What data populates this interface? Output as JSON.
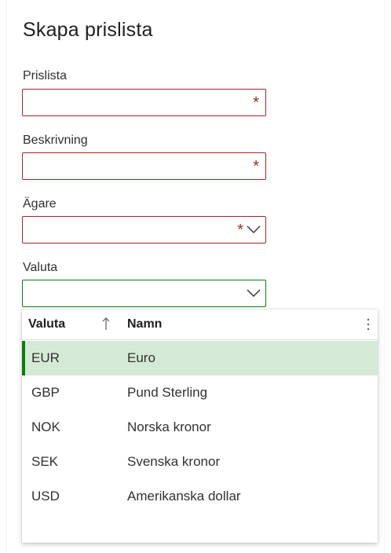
{
  "dialog": {
    "title": "Skapa prislista"
  },
  "fields": {
    "prislista": {
      "label": "Prislista",
      "value": "",
      "required": true
    },
    "beskrivning": {
      "label": "Beskrivning",
      "value": "",
      "required": true
    },
    "agare": {
      "label": "Ägare",
      "value": "",
      "required": true,
      "icon": "chevron-down-icon"
    },
    "valuta": {
      "label": "Valuta",
      "value": "",
      "icon": "chevron-down-icon"
    }
  },
  "required_marker": "*",
  "lookup": {
    "columns": {
      "code": "Valuta",
      "name": "Namn",
      "sort_icon": "arrow-up-icon",
      "more_icon": "more-vertical-icon"
    },
    "rows": [
      {
        "code": "EUR",
        "name": "Euro",
        "selected": true
      },
      {
        "code": "GBP",
        "name": "Pund Sterling"
      },
      {
        "code": "NOK",
        "name": "Norska kronor"
      },
      {
        "code": "SEK",
        "name": "Svenska kronor"
      },
      {
        "code": "USD",
        "name": "Amerikanska dollar"
      }
    ]
  },
  "colors": {
    "required": "#a4262c",
    "valid": "#107c10",
    "selected_row": "#d4ead7"
  }
}
